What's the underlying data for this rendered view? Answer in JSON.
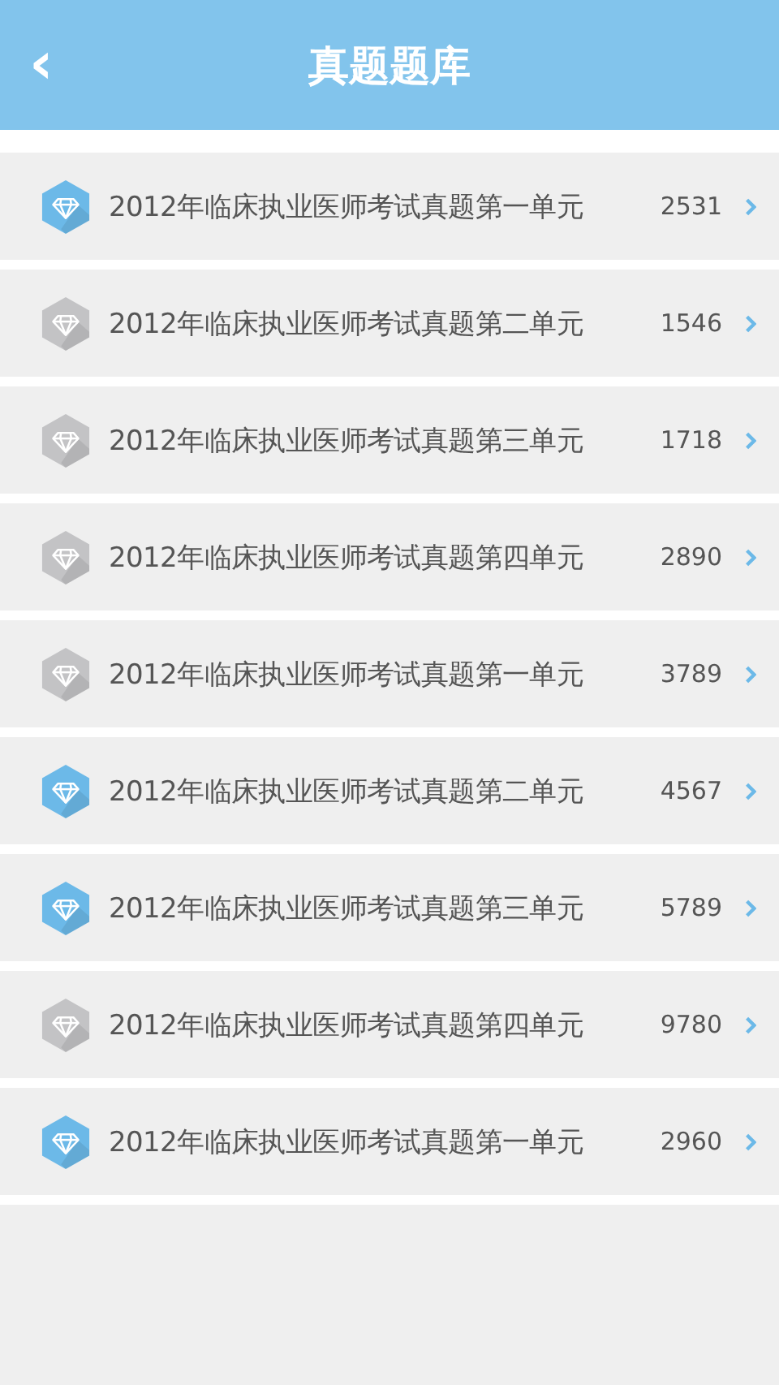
{
  "header": {
    "back": "‹",
    "title": "真题题库"
  },
  "items": [
    {
      "title": "2012年临床执业医师考试真题第一单元",
      "count": "2531",
      "color": "#6cb9e8"
    },
    {
      "title": "2012年临床执业医师考试真题第二单元",
      "count": "1546",
      "color": "#c3c3c5"
    },
    {
      "title": "2012年临床执业医师考试真题第三单元",
      "count": "1718",
      "color": "#c3c3c5"
    },
    {
      "title": "2012年临床执业医师考试真题第四单元",
      "count": "2890",
      "color": "#c3c3c5"
    },
    {
      "title": "2012年临床执业医师考试真题第一单元",
      "count": "3789",
      "color": "#c3c3c5"
    },
    {
      "title": "2012年临床执业医师考试真题第二单元",
      "count": "4567",
      "color": "#6cb9e8"
    },
    {
      "title": "2012年临床执业医师考试真题第三单元",
      "count": "5789",
      "color": "#6cb9e8"
    },
    {
      "title": "2012年临床执业医师考试真题第四单元",
      "count": "9780",
      "color": "#c3c3c5"
    },
    {
      "title": "2012年临床执业医师考试真题第一单元",
      "count": "2960",
      "color": "#6cb9e8"
    }
  ]
}
